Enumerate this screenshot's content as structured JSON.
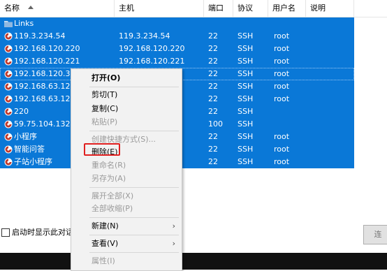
{
  "columns": {
    "name": "名称",
    "host": "主机",
    "port": "端口",
    "protocol": "协议",
    "user": "用户名",
    "desc": "说明"
  },
  "rows": [
    {
      "name": "Links",
      "host": "",
      "port": "",
      "protocol": "",
      "user": "",
      "icon": "folder-icon"
    },
    {
      "name": "119.3.234.54",
      "host": "119.3.234.54",
      "port": "22",
      "protocol": "SSH",
      "user": "root",
      "icon": "session-icon"
    },
    {
      "name": "192.168.120.220",
      "host": "192.168.120.220",
      "port": "22",
      "protocol": "SSH",
      "user": "root",
      "icon": "session-icon"
    },
    {
      "name": "192.168.120.221",
      "host": "192.168.120.221",
      "port": "22",
      "protocol": "SSH",
      "user": "root",
      "icon": "session-icon"
    },
    {
      "name": "192.168.120.36",
      "host": "",
      "port": "22",
      "protocol": "SSH",
      "user": "root",
      "icon": "session-icon"
    },
    {
      "name": "192.168.63.128",
      "host": "",
      "port": "22",
      "protocol": "SSH",
      "user": "root",
      "icon": "session-icon"
    },
    {
      "name": "192.168.63.129",
      "host": "",
      "port": "22",
      "protocol": "SSH",
      "user": "root",
      "icon": "session-icon"
    },
    {
      "name": "220",
      "host": "",
      "port": "22",
      "protocol": "SSH",
      "user": "",
      "icon": "session-icon"
    },
    {
      "name": "59.75.104.132",
      "host": "",
      "port": "100",
      "protocol": "SSH",
      "user": "",
      "icon": "session-icon"
    },
    {
      "name": "小程序",
      "host": "",
      "port": "22",
      "protocol": "SSH",
      "user": "root",
      "icon": "session-icon"
    },
    {
      "name": "智能问答",
      "host": "",
      "port": "22",
      "protocol": "SSH",
      "user": "root",
      "icon": "session-icon"
    },
    {
      "name": "子站小程序",
      "host": "",
      "port": "22",
      "protocol": "SSH",
      "user": "root",
      "icon": "session-icon"
    }
  ],
  "context_menu": {
    "open": "打开(O)",
    "cut": "剪切(T)",
    "copy": "复制(C)",
    "paste": "粘贴(P)",
    "create_shortcut": "创建快捷方式(S)...",
    "delete": "删除(E)",
    "rename": "重命名(R)",
    "save_as": "另存为(A)",
    "expand_all": "展开全部(X)",
    "collapse_all": "全部收缩(P)",
    "new": "新建(N)",
    "view": "查看(V)",
    "properties": "属性(I)",
    "submenu_arrow": "›"
  },
  "footer": {
    "startup_checkbox": "启动时显示此对话框",
    "connect_button": "连"
  },
  "colors": {
    "selection": "#0a78d7",
    "highlight_box": "#e02020",
    "session_icon": "#c0392b"
  }
}
